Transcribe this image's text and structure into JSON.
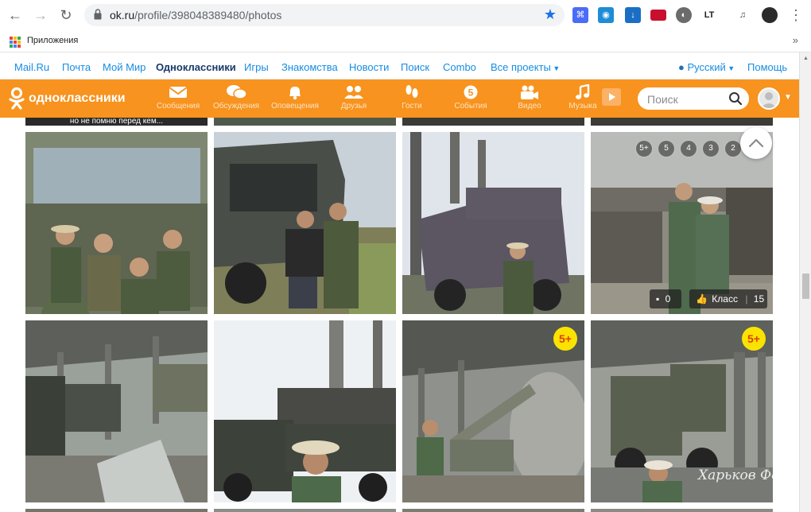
{
  "browser": {
    "url_host": "ok.ru",
    "url_path": "/profile/398048389480/photos",
    "bookmarks_apps_label": "Приложения",
    "more_label": "»"
  },
  "portal": {
    "links": [
      "Mail.Ru",
      "Почта",
      "Мой Мир",
      "Одноклассники",
      "Игры",
      "Знакомства",
      "Новости",
      "Поиск",
      "Combo",
      "Все проекты"
    ],
    "language": "Русский",
    "help": "Помощь"
  },
  "toolbar": {
    "brand": "одноклассники",
    "items": [
      {
        "label": "Сообщения",
        "icon": "envelope-icon"
      },
      {
        "label": "Обсуждения",
        "icon": "chat-bubbles-icon"
      },
      {
        "label": "Оповещения",
        "icon": "bell-icon"
      },
      {
        "label": "Друзья",
        "icon": "friends-icon"
      },
      {
        "label": "Гости",
        "icon": "footprints-icon"
      },
      {
        "label": "События",
        "icon": "events-icon"
      },
      {
        "label": "Видео",
        "icon": "video-camera-icon"
      },
      {
        "label": "Музыка",
        "icon": "music-note-icon"
      }
    ],
    "search_placeholder": "Поиск"
  },
  "photos": {
    "top_caption": "но не помню перед кем...",
    "badge": "5+",
    "marks": [
      "5+",
      "5",
      "4",
      "3",
      "2"
    ],
    "comments_count": "0",
    "class_label": "Класс",
    "class_count": "15"
  },
  "watermark": "Харьков Форум",
  "colors": {
    "ok_orange": "#f7931e",
    "link_blue": "#168de2",
    "badge_yellow": "#fbe300"
  }
}
